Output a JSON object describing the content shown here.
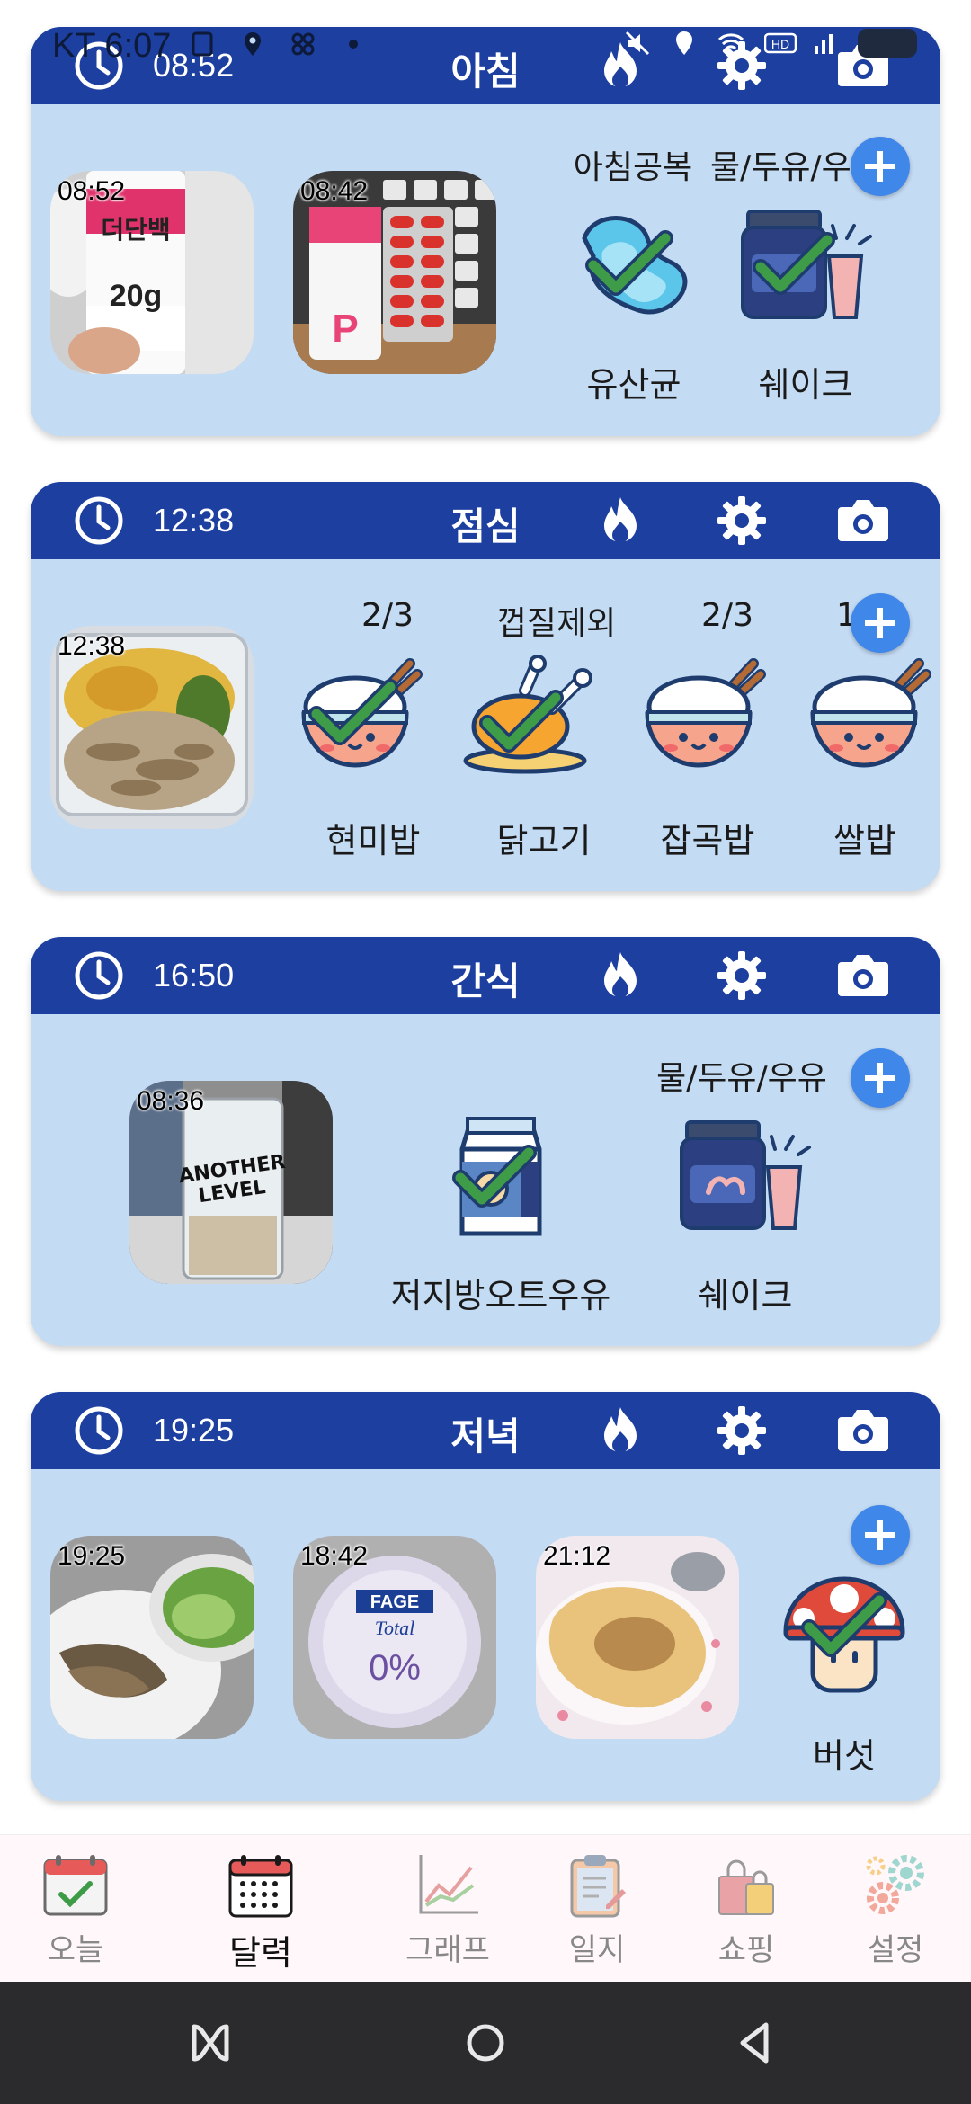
{
  "status_bar": {
    "carrier_time": "KT 6:07"
  },
  "meals": [
    {
      "key": "breakfast",
      "time": "08:52",
      "title": "아침",
      "photos": [
        {
          "time": "08:52"
        },
        {
          "time": "08:42"
        }
      ],
      "foods": [
        {
          "note": "아침공복",
          "label": "유산균",
          "icon": "probiotic-icon",
          "checked": true
        },
        {
          "note": "물/두유/우",
          "label": "쉐이크",
          "icon": "protein-shake-icon",
          "checked": true
        }
      ]
    },
    {
      "key": "lunch",
      "time": "12:38",
      "title": "점심",
      "photos": [
        {
          "time": "12:38"
        }
      ],
      "foods": [
        {
          "note": "2/3",
          "label": "현미밥",
          "icon": "rice-bowl-icon",
          "checked": true
        },
        {
          "note": "껍질제외",
          "label": "닭고기",
          "icon": "chicken-icon",
          "checked": true
        },
        {
          "note": "2/3",
          "label": "잡곡밥",
          "icon": "rice-bowl-icon",
          "checked": false
        },
        {
          "note": "1",
          "label": "쌀밥",
          "icon": "rice-bowl-icon",
          "checked": false
        }
      ]
    },
    {
      "key": "snack",
      "time": "16:50",
      "title": "간식",
      "photos": [
        {
          "time": "08:36"
        }
      ],
      "foods": [
        {
          "note": "",
          "label": "저지방오트우유",
          "icon": "milk-carton-icon",
          "checked": true
        },
        {
          "note": "물/두유/우유",
          "label": "쉐이크",
          "icon": "protein-shake-icon",
          "checked": false
        }
      ]
    },
    {
      "key": "dinner",
      "time": "19:25",
      "title": "저녁",
      "photos": [
        {
          "time": "19:25"
        },
        {
          "time": "18:42"
        },
        {
          "time": "21:12"
        }
      ],
      "foods": [
        {
          "note": "",
          "label": "버섯",
          "icon": "mushroom-icon",
          "checked": true
        }
      ]
    }
  ],
  "bottom_nav": [
    {
      "label": "오늘",
      "icon": "calendar-check-icon",
      "active": false
    },
    {
      "label": "달력",
      "icon": "calendar-grid-icon",
      "active": true
    },
    {
      "label": "그래프",
      "icon": "line-graph-icon",
      "active": false
    },
    {
      "label": "일지",
      "icon": "clipboard-icon",
      "active": false
    },
    {
      "label": "쇼핑",
      "icon": "shopping-bag-icon",
      "active": false
    },
    {
      "label": "설정",
      "icon": "gears-icon",
      "active": false
    }
  ],
  "colors": {
    "header": "#1c3fa0",
    "card": "#c4dbf4",
    "add_button": "#3f87e9",
    "check": "#2d8a3e"
  }
}
